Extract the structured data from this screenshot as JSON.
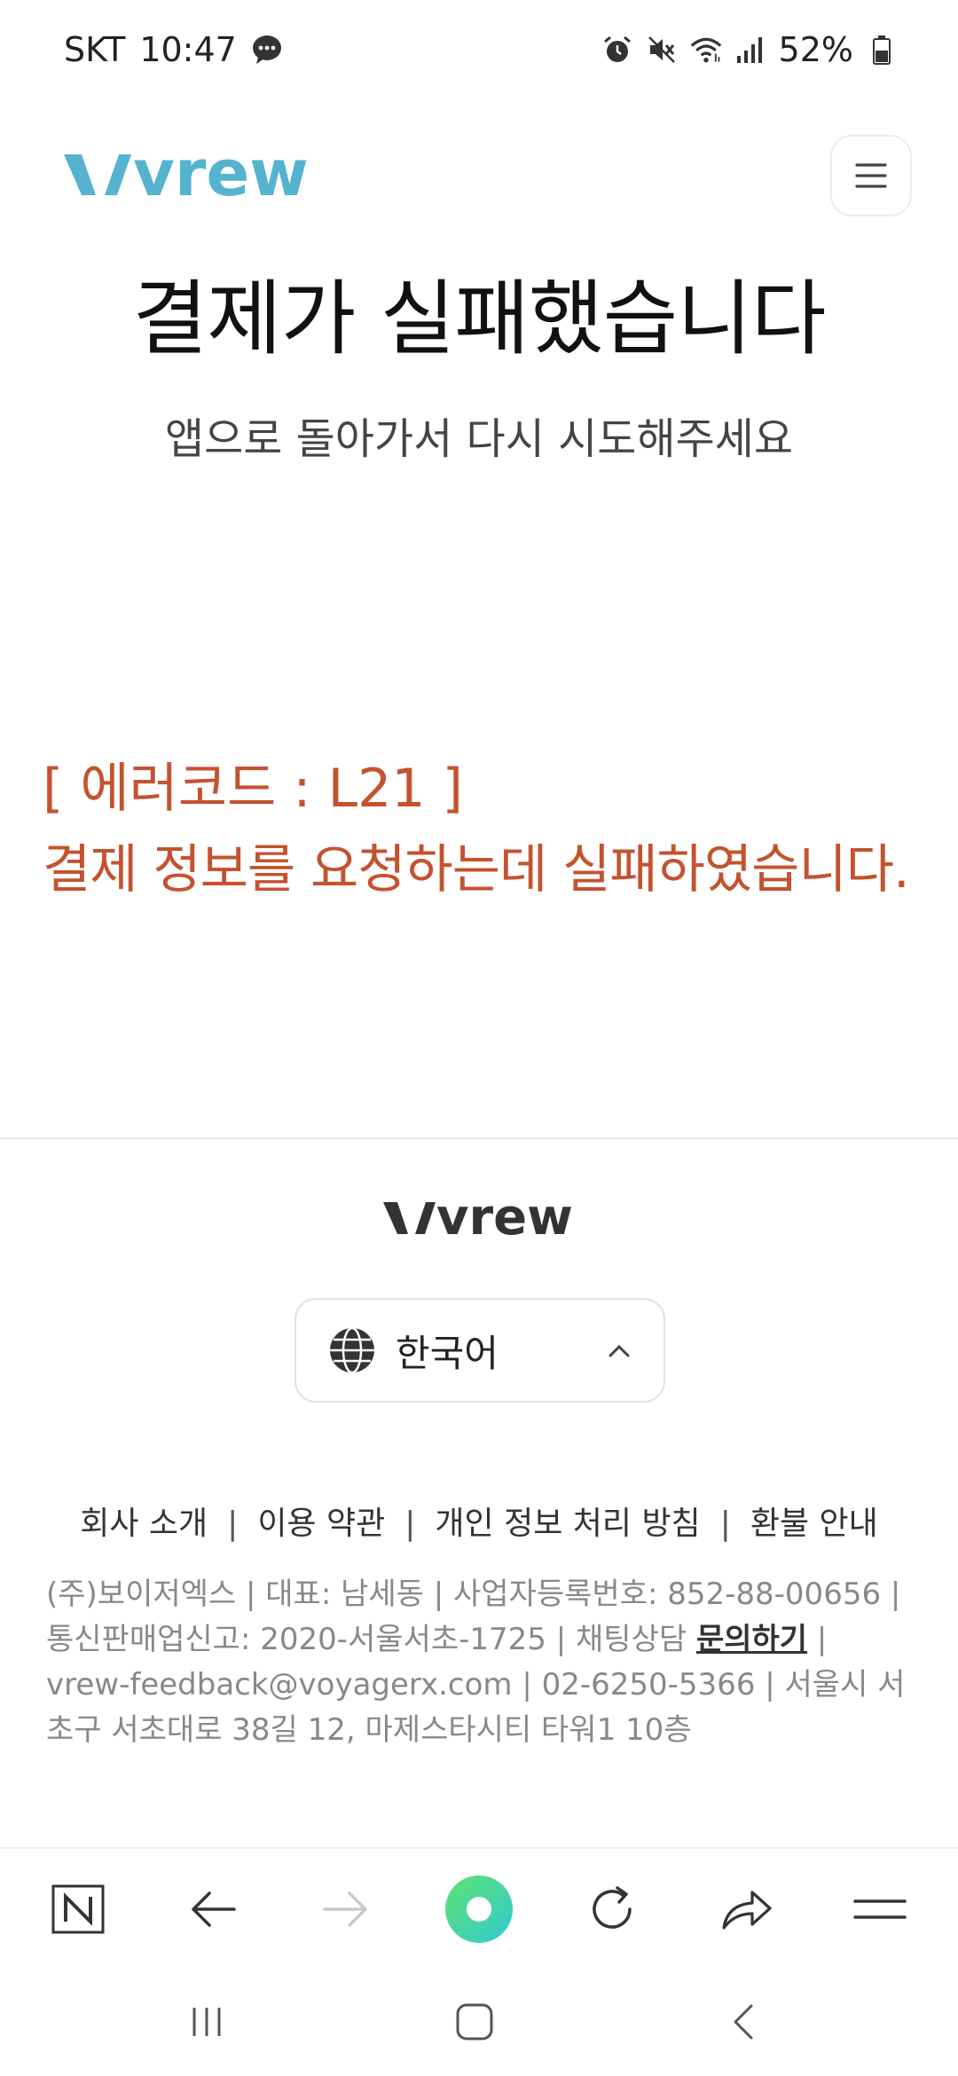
{
  "status_bar": {
    "carrier": "SKT",
    "time": "10:47",
    "battery": "52%",
    "icons": [
      "message-icon",
      "alarm-icon",
      "mute-icon",
      "wifi-icon",
      "signal-icon",
      "battery-icon"
    ]
  },
  "header": {
    "logo_text": "vrew",
    "menu_icon": "hamburger-menu-icon",
    "brand_color": "#55b3cf"
  },
  "main": {
    "title": "결제가 실패했습니다",
    "subtitle": "앱으로 돌아가서 다시 시도해주세요",
    "error_code": "[ 에러코드 : L21 ]",
    "error_message": "결제 정보를 요청하는데 실패하였습니다.",
    "error_color": "#c4522f"
  },
  "footer": {
    "logo_text": "vrew",
    "language": {
      "selected": "한국어",
      "icon": "globe-icon",
      "chevron": "chevron-up-icon"
    },
    "links": [
      "회사 소개",
      "이용 약관",
      "개인 정보 처리 방침",
      "환불 안내"
    ],
    "company_info_pre": "(주)보이저엑스 | 대표: 남세동 | 사업자등록번호: 852-88-00656 | 통신판매업신고: 2020-서울서초-1725 | 채팅상담 ",
    "chat_link": "문의하기",
    "company_info_post": " | vrew-feedback@voyagerx.com | 02-6250-5366 | 서울시 서초구 서초대로 38길 12, 마제스타시티 타워1 10층"
  },
  "browser_toolbar": {
    "items": [
      "naver-home-icon",
      "back-arrow-icon",
      "forward-arrow-icon",
      "green-dot-icon",
      "refresh-icon",
      "share-icon",
      "menu-icon"
    ]
  },
  "system_nav": {
    "items": [
      "recent-apps-icon",
      "home-icon",
      "back-icon"
    ]
  }
}
